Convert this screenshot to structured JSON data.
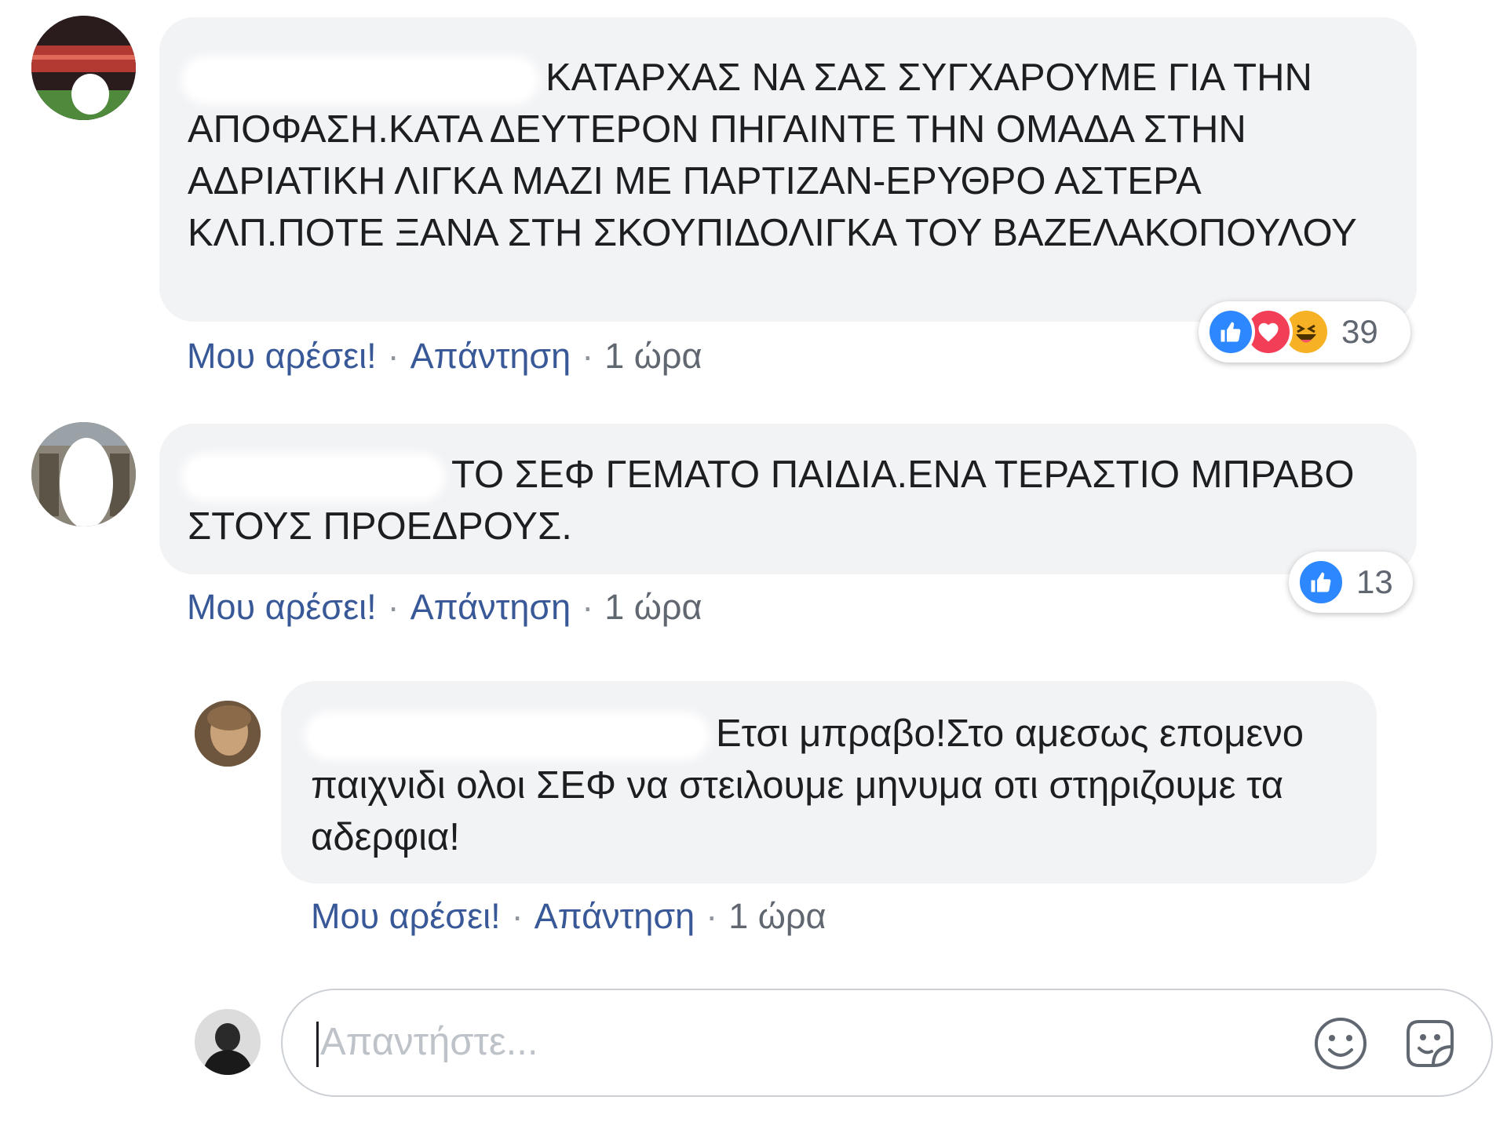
{
  "comments": [
    {
      "text": "ΚΑΤΑΡΧΑΣ ΝΑ ΣΑΣ ΣΥΓΧΑΡΟΥΜΕ ΓΙΑ ΤΗΝ ΑΠΟΦΑΣΗ.ΚΑΤΑ ΔΕΥΤΕΡΟΝ ΠΗΓΑΙΝΤΕ ΤΗΝ ΟΜΑΔΑ ΣΤΗΝ ΑΔΡΙΑΤΙΚΗ ΛΙΓΚΑ ΜΑΖΙ ΜΕ ΠΑΡΤΙΖΑΝ-ΕΡΥΘΡΟ ΑΣΤΕΡΑ ΚΛΠ.ΠΟΤΕ ΞΑΝΑ ΣΤΗ ΣΚΟΥΠΙΔΟΛΙΓΚΑ ΤΟΥ ΒΑΖΕΛΑΚΟΠΟΥΛΟΥ",
      "like_label": "Μου αρέσει!",
      "separator": "·",
      "reply_label": "Απάντηση",
      "time": "1 ώρα",
      "reaction_icons": [
        "like-icon",
        "love-icon",
        "haha-icon"
      ],
      "reaction_count": "39"
    },
    {
      "text": "ΤΟ ΣΕΦ ΓΕΜΑΤΟ ΠΑΙΔΙΑ.ΕΝΑ ΤΕΡΑΣΤΙΟ ΜΠΡΑΒΟ ΣΤΟΥΣ ΠΡΟΕΔΡΟΥΣ.",
      "like_label": "Μου αρέσει!",
      "separator": "·",
      "reply_label": "Απάντηση",
      "time": "1 ώρα",
      "reaction_icons": [
        "like-icon"
      ],
      "reaction_count": "13"
    }
  ],
  "reply": {
    "text": "Ετσι μπραβο!Στο αμεσως επομενο παιχνιδι ολοι ΣΕΦ να στειλουμε μηνυμα οτι στηριζουμε τα αδερφια!",
    "like_label": "Μου αρέσει!",
    "separator": "·",
    "reply_label": "Απάντηση",
    "time": "1 ώρα"
  },
  "composer": {
    "placeholder": "Απαντήστε...",
    "icons": [
      "emoji-icon",
      "sticker-icon"
    ]
  },
  "colors": {
    "bubble": "#f2f3f5",
    "link": "#385898",
    "like": "#2d88ff",
    "love": "#f33e58",
    "haha": "#f7b125"
  }
}
